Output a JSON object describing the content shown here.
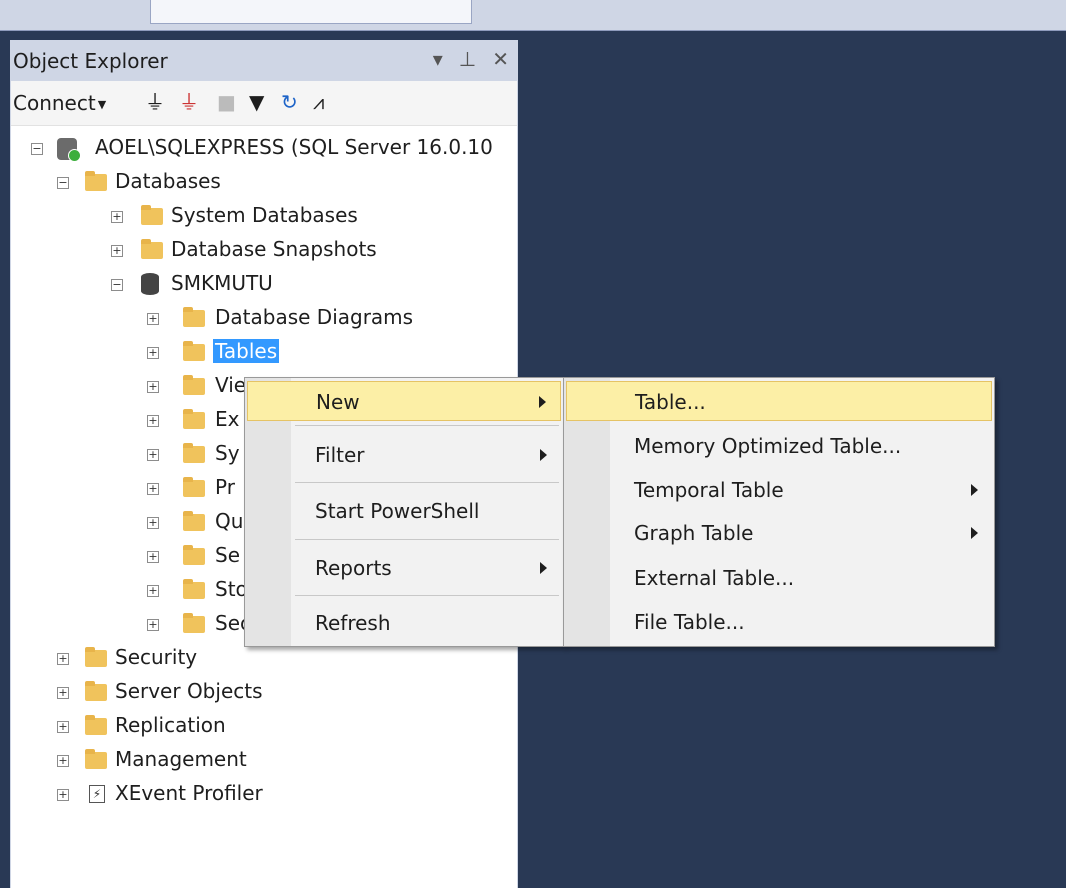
{
  "object_explorer": {
    "title": "Object Explorer",
    "header_icons": [
      "chevron-down-icon",
      "pin-icon",
      "close-icon"
    ],
    "toolbar": {
      "connect_label": "Connect",
      "icons": [
        "connect-icon",
        "disconnect-icon",
        "stop-icon",
        "filter-icon",
        "refresh-icon",
        "activity-monitor-icon"
      ]
    },
    "tree": {
      "server": "AOEL\\SQLEXPRESS (SQL Server 16.0.10",
      "databases": "Databases",
      "system_databases": "System Databases",
      "database_snapshots": "Database Snapshots",
      "db_name": "SMKMUTU",
      "db_children": {
        "database_diagrams": "Database Diagrams",
        "tables": "Tables",
        "views": "Vie",
        "external": "Ex",
        "synonyms": "Sy",
        "programmability": "Pr",
        "query_store": "Qu",
        "service_broker": "Se",
        "storage": "Sto",
        "security": "Security"
      },
      "security": "Security",
      "server_objects": "Server Objects",
      "replication": "Replication",
      "management": "Management",
      "xevent_profiler": "XEvent Profiler"
    }
  },
  "context_menu": {
    "items": [
      "New",
      "Filter",
      "Start PowerShell",
      "Reports",
      "Refresh"
    ]
  },
  "submenu": {
    "items": [
      "Table...",
      "Memory Optimized Table...",
      "Temporal Table",
      "Graph Table",
      "External Table...",
      "File Table..."
    ]
  }
}
